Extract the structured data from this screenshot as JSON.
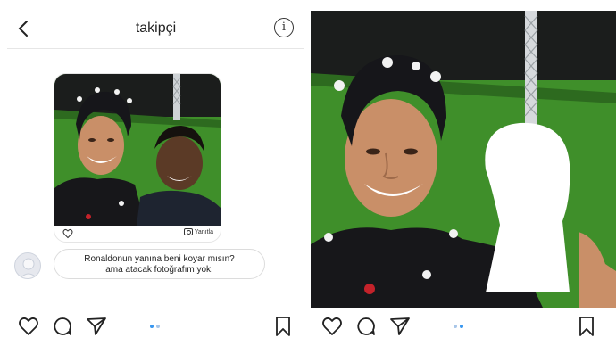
{
  "left": {
    "header": {
      "back_icon": "chevron-left-icon",
      "title": "takipçi",
      "info_icon": "info-icon",
      "info_glyph": "i"
    },
    "shared_post": {
      "like_icon": "heart-outline-icon",
      "reply_label": "Yanıtla",
      "reply_icon": "camera-icon"
    },
    "message": {
      "line1": "Ronaldonun yanına beni koyar mısın?",
      "line2": "ama atacak fotoğrafım yok."
    }
  },
  "action_bar": {
    "like_icon": "heart-icon",
    "comment_icon": "comment-icon",
    "share_icon": "paper-plane-icon",
    "save_icon": "bookmark-icon",
    "carousel_active_color": "#3897f0",
    "carousel_inactive_color": "#a8c6e8"
  },
  "colors": {
    "field_green": "#3f8f2a",
    "wall_dark": "#1b1d1c",
    "cap_black": "#16161a",
    "skin": "#c98f68",
    "silhouette": "#ffffff"
  }
}
